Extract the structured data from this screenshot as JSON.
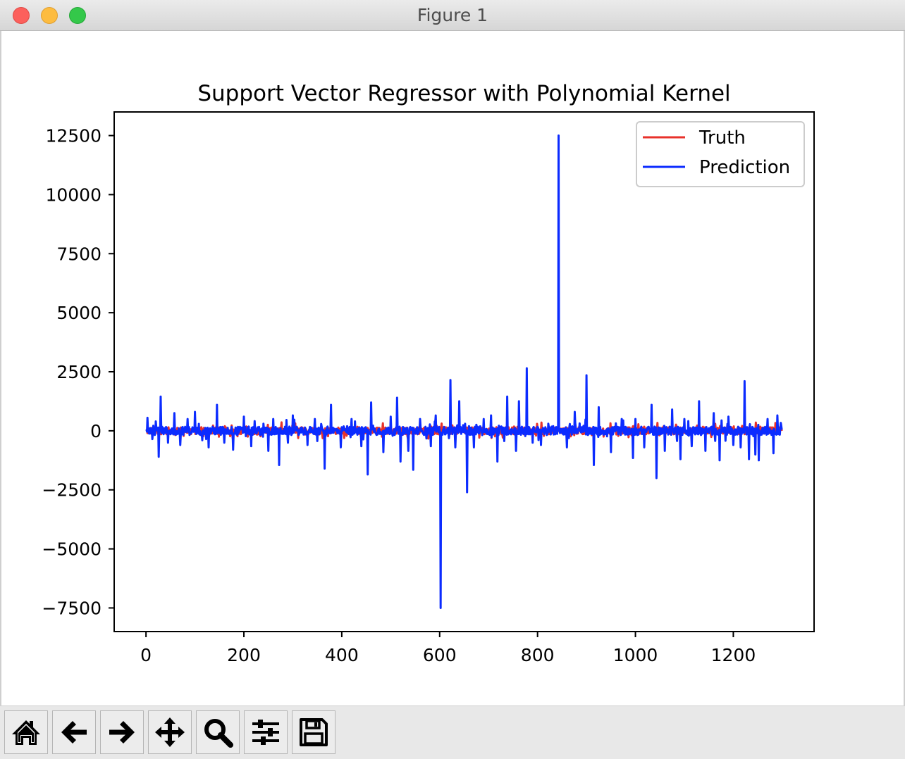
{
  "window": {
    "title": "Figure 1"
  },
  "toolbar": {
    "buttons": [
      {
        "name": "home",
        "icon": "home-icon"
      },
      {
        "name": "back",
        "icon": "arrow-left-icon"
      },
      {
        "name": "forward",
        "icon": "arrow-right-icon"
      },
      {
        "name": "pan",
        "icon": "move-arrows-icon"
      },
      {
        "name": "zoom",
        "icon": "magnifier-icon"
      },
      {
        "name": "configure-subplots",
        "icon": "sliders-icon"
      },
      {
        "name": "save",
        "icon": "floppy-disk-icon"
      }
    ]
  },
  "chart_data": {
    "type": "line",
    "title": "Support Vector Regressor with Polynomial Kernel",
    "xlabel": "",
    "ylabel": "",
    "xlim": [
      -65,
      1365
    ],
    "ylim": [
      -8500,
      13500
    ],
    "xticks": [
      0,
      200,
      400,
      600,
      800,
      1000,
      1200
    ],
    "xtick_labels": [
      "0",
      "200",
      "400",
      "600",
      "800",
      "1000",
      "1200"
    ],
    "yticks": [
      12500,
      10000,
      7500,
      5000,
      2500,
      0,
      -2500,
      -5000,
      -7500
    ],
    "ytick_labels": [
      "12500",
      "10000",
      "7500",
      "5000",
      "2500",
      "0",
      "−2500",
      "−5000",
      "−7500"
    ],
    "grid": false,
    "legend_position": "top-right",
    "n_points": 1300,
    "series": [
      {
        "name": "Truth",
        "color": "#e8322b",
        "style": "noise",
        "amplitude": 250
      },
      {
        "name": "Prediction",
        "color": "#0b2bff",
        "style": "noise",
        "amplitude": 300,
        "spikes": [
          [
            3,
            550
          ],
          [
            13,
            -350
          ],
          [
            20,
            400
          ],
          [
            26,
            -1100
          ],
          [
            30,
            1450
          ],
          [
            45,
            -500
          ],
          [
            58,
            750
          ],
          [
            70,
            -600
          ],
          [
            85,
            500
          ],
          [
            100,
            800
          ],
          [
            115,
            -400
          ],
          [
            128,
            -700
          ],
          [
            145,
            1100
          ],
          [
            160,
            -500
          ],
          [
            178,
            -800
          ],
          [
            200,
            600
          ],
          [
            215,
            -650
          ],
          [
            240,
            300
          ],
          [
            250,
            -850
          ],
          [
            260,
            500
          ],
          [
            272,
            -1450
          ],
          [
            290,
            -500
          ],
          [
            300,
            650
          ],
          [
            330,
            -600
          ],
          [
            345,
            500
          ],
          [
            365,
            -1600
          ],
          [
            378,
            1100
          ],
          [
            398,
            -700
          ],
          [
            420,
            500
          ],
          [
            440,
            -650
          ],
          [
            453,
            -1850
          ],
          [
            460,
            1200
          ],
          [
            485,
            -900
          ],
          [
            500,
            600
          ],
          [
            513,
            1400
          ],
          [
            520,
            -1300
          ],
          [
            536,
            -850
          ],
          [
            546,
            -1650
          ],
          [
            560,
            500
          ],
          [
            582,
            -650
          ],
          [
            592,
            650
          ],
          [
            602,
            -7500
          ],
          [
            622,
            2150
          ],
          [
            632,
            -700
          ],
          [
            640,
            1250
          ],
          [
            656,
            -2600
          ],
          [
            670,
            -700
          ],
          [
            690,
            500
          ],
          [
            705,
            650
          ],
          [
            718,
            -1300
          ],
          [
            738,
            1450
          ],
          [
            756,
            -850
          ],
          [
            762,
            1250
          ],
          [
            778,
            2650
          ],
          [
            790,
            -500
          ],
          [
            807,
            -600
          ],
          [
            822,
            300
          ],
          [
            843,
            12500
          ],
          [
            860,
            -700
          ],
          [
            876,
            800
          ],
          [
            900,
            2350
          ],
          [
            915,
            -1450
          ],
          [
            925,
            1000
          ],
          [
            950,
            -900
          ],
          [
            972,
            500
          ],
          [
            995,
            -1150
          ],
          [
            1000,
            500
          ],
          [
            1018,
            -700
          ],
          [
            1033,
            1100
          ],
          [
            1043,
            -2000
          ],
          [
            1060,
            -850
          ],
          [
            1075,
            900
          ],
          [
            1092,
            -1200
          ],
          [
            1100,
            500
          ],
          [
            1115,
            -650
          ],
          [
            1130,
            1250
          ],
          [
            1143,
            -850
          ],
          [
            1160,
            750
          ],
          [
            1172,
            -1250
          ],
          [
            1190,
            600
          ],
          [
            1200,
            -600
          ],
          [
            1215,
            -700
          ],
          [
            1223,
            2100
          ],
          [
            1232,
            -1200
          ],
          [
            1245,
            -1000
          ],
          [
            1252,
            -1250
          ],
          [
            1270,
            500
          ],
          [
            1282,
            -950
          ],
          [
            1290,
            650
          ],
          [
            1298,
            200
          ]
        ]
      }
    ]
  }
}
